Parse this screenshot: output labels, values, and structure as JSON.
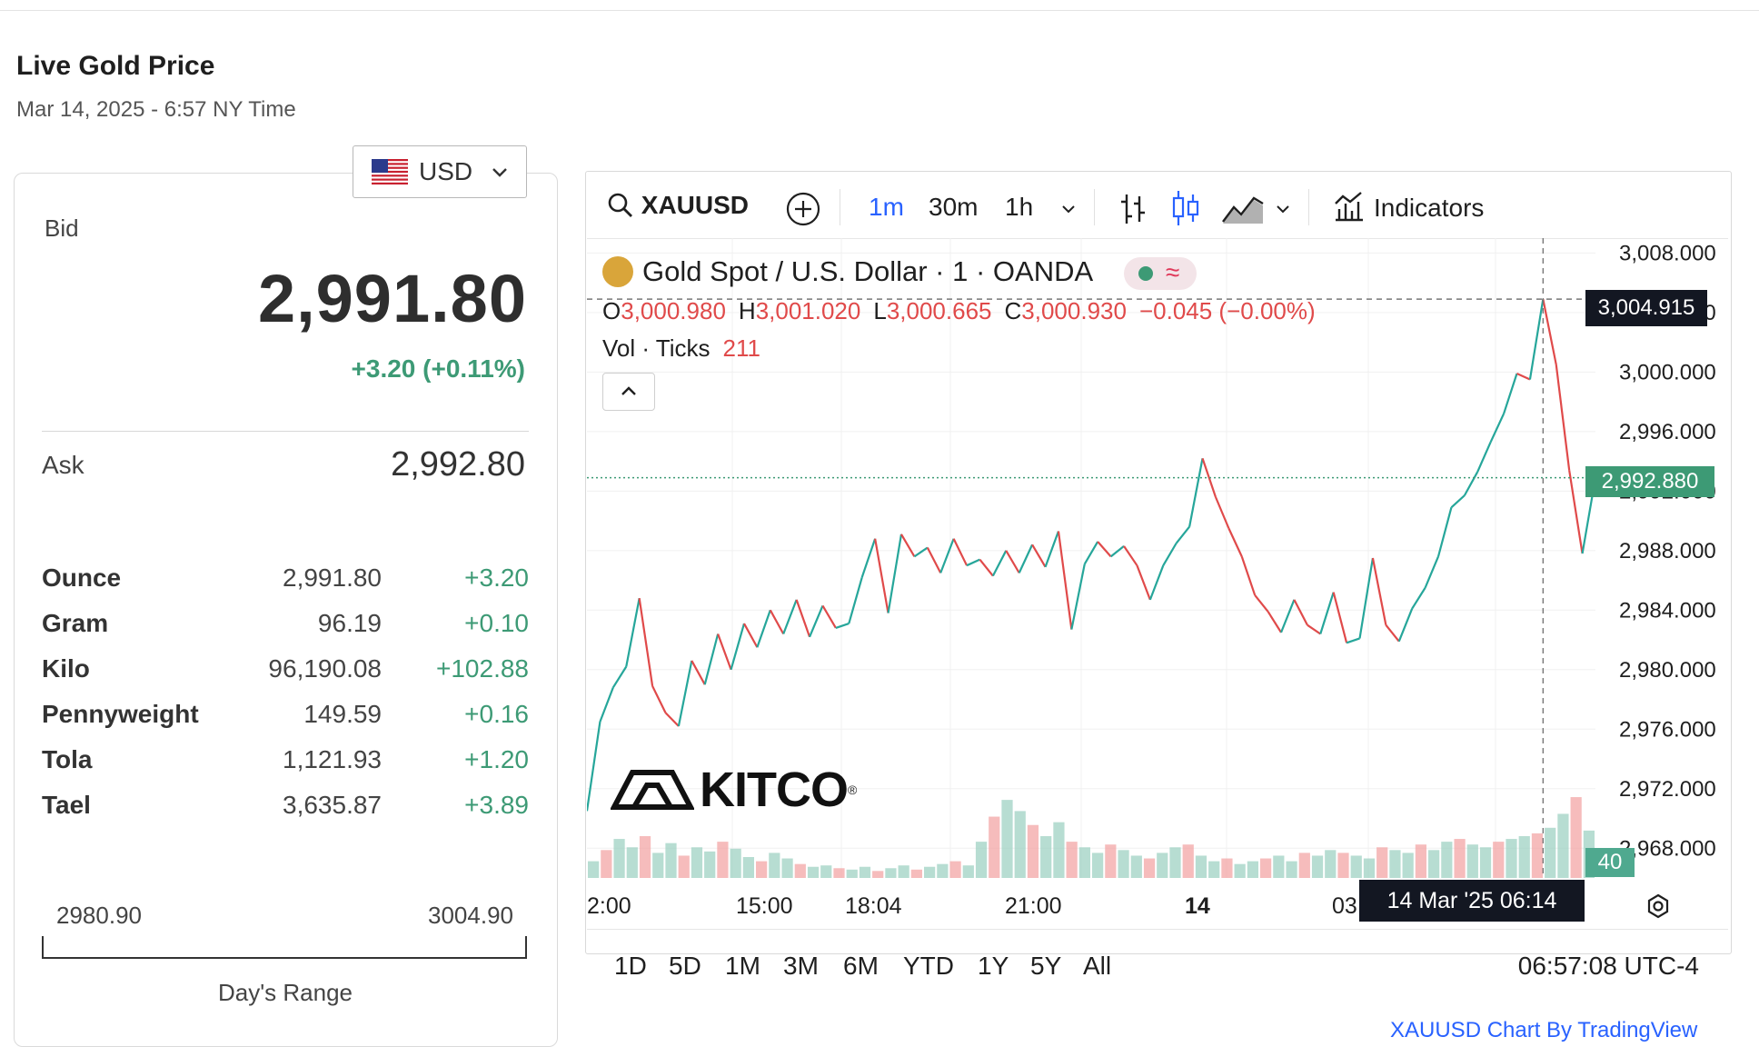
{
  "header": {
    "title": "Live Gold Price",
    "subtitle": "Mar 14, 2025 - 6:57 NY Time"
  },
  "currency": {
    "selected": "USD"
  },
  "price_card": {
    "bid_label": "Bid",
    "bid_value": "2,991.80",
    "bid_change": "+3.20 (+0.11%)",
    "ask_label": "Ask",
    "ask_value": "2,992.80",
    "units": [
      {
        "name": "Ounce",
        "value": "2,991.80",
        "change": "+3.20"
      },
      {
        "name": "Gram",
        "value": "96.19",
        "change": "+0.10"
      },
      {
        "name": "Kilo",
        "value": "96,190.08",
        "change": "+102.88"
      },
      {
        "name": "Pennyweight",
        "value": "149.59",
        "change": "+0.16"
      },
      {
        "name": "Tola",
        "value": "1,121.93",
        "change": "+1.20"
      },
      {
        "name": "Tael",
        "value": "3,635.87",
        "change": "+3.89"
      }
    ],
    "range_low": "2980.90",
    "range_high": "3004.90",
    "range_label": "Day's Range"
  },
  "toolbar": {
    "symbol": "XAUUSD",
    "intervals": [
      "1m",
      "30m",
      "1h"
    ],
    "active_interval": "1m",
    "indicators_label": "Indicators"
  },
  "chart_legend": {
    "instrument": "Gold Spot / U.S. Dollar · 1 · OANDA",
    "eq_badge": "≈",
    "ohlc": {
      "o_key": "O",
      "o": "3,000.980",
      "h_key": "H",
      "h": "3,001.020",
      "l_key": "L",
      "l": "3,000.665",
      "c_key": "C",
      "c": "3,000.930",
      "change": "−0.045 (−0.00%)"
    },
    "vol_label": "Vol · Ticks",
    "vol_value": "211"
  },
  "chart_tags": {
    "crosshair_price": "3,004.915",
    "last_price": "2,992.880",
    "volume": "40",
    "crosshair_time": "14 Mar '25   06:14"
  },
  "brand": {
    "name": "KITCO",
    "mark": "®"
  },
  "chart_data": {
    "type": "line",
    "x_labels": [
      "2:00",
      "15:00",
      "18:04",
      "21:00",
      "14",
      "03"
    ],
    "y_ticks": [
      "3,008.000",
      "3,004.000",
      "3,000.000",
      "2,996.000",
      "2,992.000",
      "2,988.000",
      "2,984.000",
      "2,980.000",
      "2,976.000",
      "2,972.000",
      "2,968.000"
    ],
    "ylim": [
      2966,
      3009
    ],
    "series": [
      {
        "values": [
          2970.5,
          2976.5,
          2978.8,
          2980.2,
          2984.8,
          2978.9,
          2977.1,
          2976.2,
          2980.6,
          2979.0,
          2982.4,
          2980.0,
          2983.1,
          2981.5,
          2984.0,
          2982.4,
          2984.7,
          2982.2,
          2984.3,
          2982.8,
          2983.1,
          2986.2,
          2988.8,
          2983.8,
          2989.1,
          2987.6,
          2988.2,
          2986.5,
          2988.8,
          2987.0,
          2987.4,
          2986.3,
          2988.0,
          2986.5,
          2988.4,
          2986.9,
          2989.3,
          2982.7,
          2987.1,
          2988.6,
          2987.6,
          2988.3,
          2987.0,
          2984.7,
          2987.0,
          2988.5,
          2989.6,
          2994.2,
          2991.6,
          2989.5,
          2987.6,
          2985.0,
          2983.9,
          2982.5,
          2984.7,
          2983.0,
          2982.4,
          2985.2,
          2981.8,
          2982.1,
          2987.5,
          2983.0,
          2981.9,
          2984.1,
          2985.5,
          2987.6,
          2990.9,
          2991.7,
          2993.3,
          2995.3,
          2997.2,
          2999.9,
          2999.5,
          3004.9,
          3000.5,
          2993.4,
          2987.8,
          2992.9
        ]
      }
    ],
    "volume": [
      12,
      20,
      28,
      22,
      30,
      18,
      25,
      16,
      22,
      19,
      26,
      21,
      15,
      12,
      18,
      14,
      10,
      8,
      9,
      7,
      6,
      8,
      5,
      7,
      9,
      6,
      8,
      10,
      12,
      9,
      26,
      44,
      56,
      48,
      38,
      30,
      40,
      26,
      22,
      18,
      24,
      20,
      16,
      14,
      18,
      22,
      24,
      16,
      12,
      14,
      10,
      12,
      14,
      16,
      12,
      18,
      16,
      20,
      18,
      16,
      14,
      22,
      20,
      18,
      24,
      20,
      26,
      28,
      24,
      22,
      26,
      28,
      30,
      32,
      36,
      46,
      58,
      34
    ]
  },
  "periods": {
    "items": [
      "1D",
      "5D",
      "1M",
      "3M",
      "6M",
      "YTD",
      "1Y",
      "5Y",
      "All"
    ],
    "clock": "06:57:08 UTC-4"
  },
  "footer": {
    "link": "XAUUSD Chart By TradingView"
  }
}
